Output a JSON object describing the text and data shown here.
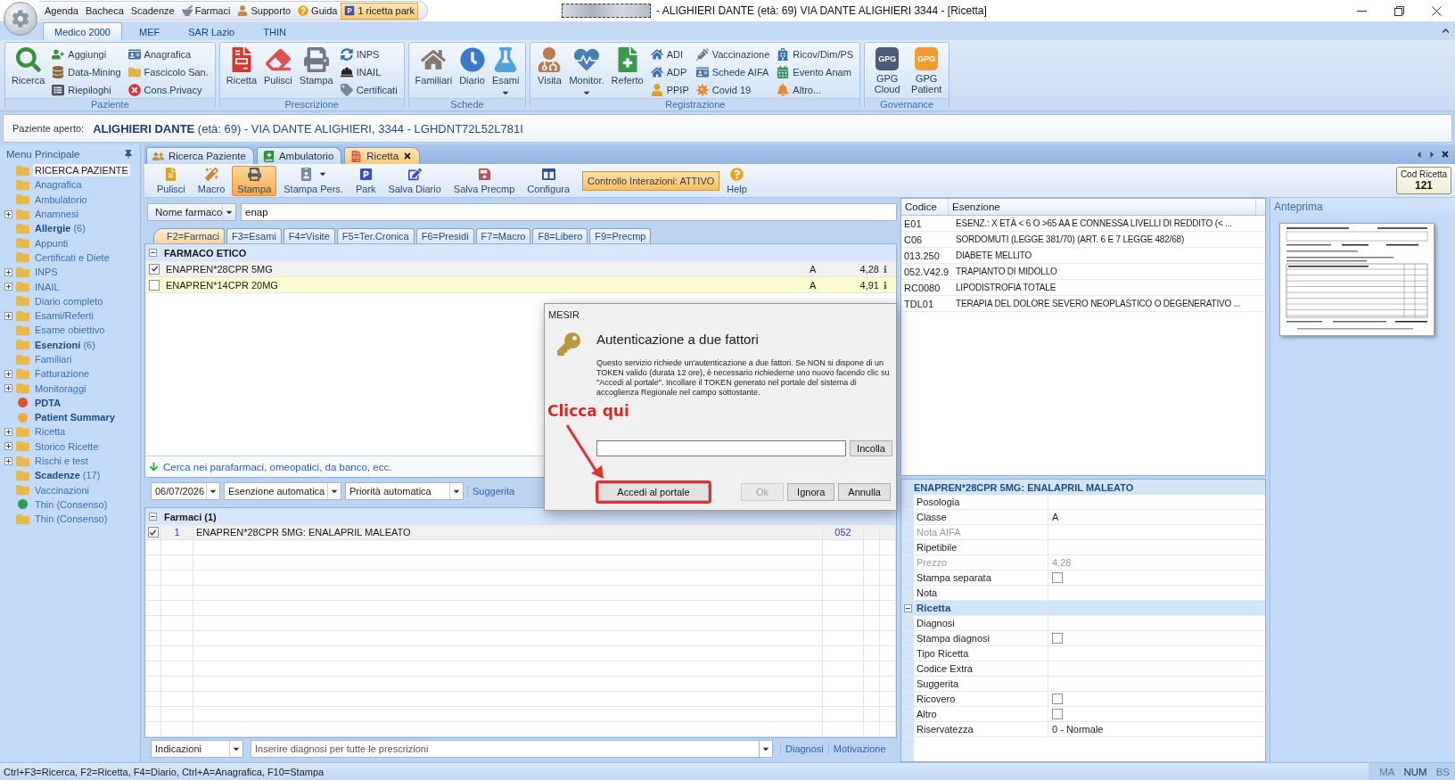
{
  "title_bar": {
    "quick_access": [
      {
        "label": "Agenda",
        "highlighted": false
      },
      {
        "label": "Bacheca",
        "highlighted": false
      },
      {
        "label": "Scadenze",
        "highlighted": false
      },
      {
        "label": "Farmaci",
        "highlighted": false
      },
      {
        "label": "Supporto",
        "highlighted": false
      },
      {
        "label": "Guida",
        "highlighted": false
      },
      {
        "label": "1 ricetta park",
        "highlighted": true
      }
    ],
    "title": "- ALIGHIERI DANTE (età: 69) VIA DANTE ALIGHIERI 3344 - [Ricetta]"
  },
  "ribbon": {
    "tabs": [
      {
        "label": "Medico 2000",
        "selected": true
      },
      {
        "label": "MEF",
        "selected": false
      },
      {
        "label": "SAR Lazio",
        "selected": false
      },
      {
        "label": "THIN",
        "selected": false
      }
    ],
    "groups": [
      {
        "label": "Paziente",
        "large": [
          {
            "label": "Ricerca",
            "dropdown": false
          }
        ],
        "columns": [
          [
            {
              "label": "Aggiungi"
            },
            {
              "label": "Data-Mining"
            },
            {
              "label": "Riepiloghi"
            }
          ],
          [
            {
              "label": "Anagrafica"
            },
            {
              "label": "Fascicolo San."
            },
            {
              "label": "Cons.Privacy"
            }
          ]
        ]
      },
      {
        "label": "Prescrizione",
        "large": [
          {
            "label": "Ricetta",
            "dropdown": false
          },
          {
            "label": "Pulisci",
            "dropdown": false
          },
          {
            "label": "Stampa",
            "dropdown": false
          }
        ],
        "columns": [
          [
            {
              "label": "INPS"
            },
            {
              "label": "INAIL"
            },
            {
              "label": "Certificati"
            }
          ]
        ]
      },
      {
        "label": "Schede",
        "large": [
          {
            "label": "Familiari",
            "dropdown": false
          },
          {
            "label": "Diario",
            "dropdown": false
          },
          {
            "label": "Esami",
            "dropdown": true
          }
        ]
      },
      {
        "label": "Registrazione",
        "large": [
          {
            "label": "Visita",
            "dropdown": false
          },
          {
            "label": "Monitor.",
            "dropdown": true
          },
          {
            "label": "Referto",
            "dropdown": false
          }
        ],
        "columns": [
          [
            {
              "label": "ADI"
            },
            {
              "label": "ADP"
            },
            {
              "label": "PPIP"
            }
          ],
          [
            {
              "label": "Vaccinazione"
            },
            {
              "label": "Schede AIFA"
            },
            {
              "label": "Covid 19"
            }
          ],
          [
            {
              "label": "Ricov/Dim/PS"
            },
            {
              "label": "Evento Anam"
            },
            {
              "label": "Altro..."
            }
          ]
        ]
      },
      {
        "label": "Governance",
        "large": [
          {
            "label": "GPG Cloud",
            "logo": "GPG",
            "color": "#4b5b78"
          },
          {
            "label": "GPG Patient",
            "logo": "GPG",
            "color": "#f39b2f"
          }
        ]
      }
    ]
  },
  "patient_bar": {
    "label": "Paziente aperto:",
    "patient": "**ALIGHIERI DANTE** (età: 69) - VIA DANTE ALIGHIERI, 3344 - LGHDNT72L52L781I"
  },
  "sidebar": {
    "title": "Menu Principale",
    "items": [
      {
        "label": "RICERCA PAZIENTE",
        "kind": "folder",
        "bold": false,
        "expandable": false,
        "selected": true
      },
      {
        "label": "Anagrafica",
        "kind": "folder",
        "bold": false,
        "expandable": false,
        "selected": false
      },
      {
        "label": "Ambulatorio",
        "kind": "folder",
        "bold": false,
        "expandable": false,
        "selected": false
      },
      {
        "label": "Anamnesi",
        "kind": "folder",
        "bold": false,
        "expandable": true,
        "selected": false
      },
      {
        "label": "Allergie",
        "count": "(6)",
        "kind": "folder",
        "bold": true,
        "expandable": false,
        "selected": false
      },
      {
        "label": "Appunti",
        "kind": "folder",
        "bold": false,
        "expandable": false,
        "selected": false
      },
      {
        "label": "Certificati e Diete",
        "kind": "folder",
        "bold": false,
        "expandable": false,
        "selected": false
      },
      {
        "label": "INPS",
        "kind": "folder",
        "bold": false,
        "expandable": true,
        "selected": false
      },
      {
        "label": "INAIL",
        "kind": "folder",
        "bold": false,
        "expandable": true,
        "selected": false
      },
      {
        "label": "Diario completo",
        "kind": "folder",
        "bold": false,
        "expandable": false,
        "selected": false
      },
      {
        "label": "Esami/Referti",
        "kind": "folder",
        "bold": false,
        "expandable": true,
        "selected": false
      },
      {
        "label": "Esame obiettivo",
        "kind": "folder",
        "bold": false,
        "expandable": false,
        "selected": false
      },
      {
        "label": "Esenzioni",
        "count": "(6)",
        "kind": "folder",
        "bold": true,
        "expandable": false,
        "selected": false
      },
      {
        "label": "Familiari",
        "kind": "folder",
        "bold": false,
        "expandable": false,
        "selected": false
      },
      {
        "label": "Fatturazione",
        "kind": "folder",
        "bold": false,
        "expandable": true,
        "selected": false
      },
      {
        "label": "Monitoraggi",
        "kind": "folder",
        "bold": false,
        "expandable": true,
        "selected": false
      },
      {
        "label": "PDTA",
        "kind": "dot",
        "color": "#e0542c",
        "bold": true,
        "expandable": false,
        "selected": false
      },
      {
        "label": "Patient Summary",
        "kind": "dot",
        "color": "#f2a93b",
        "bold": true,
        "expandable": false,
        "selected": false
      },
      {
        "label": "Ricetta",
        "kind": "folder",
        "bold": false,
        "expandable": true,
        "selected": false
      },
      {
        "label": "Storico Ricette",
        "kind": "folder",
        "bold": false,
        "expandable": true,
        "selected": false
      },
      {
        "label": "Rischi e test",
        "kind": "folder",
        "bold": false,
        "expandable": true,
        "selected": false
      },
      {
        "label": "Scadenze",
        "count": "(17)",
        "kind": "folder",
        "bold": true,
        "expandable": false,
        "selected": false
      },
      {
        "label": "Vaccinazioni",
        "kind": "folder",
        "bold": false,
        "expandable": false,
        "selected": false
      },
      {
        "label": "Thin (Consenso)",
        "kind": "dot",
        "color": "#2e9d4f",
        "bold": false,
        "expandable": false,
        "selected": false
      },
      {
        "label": "Thin (Consenso)",
        "kind": "folder",
        "bold": false,
        "expandable": false,
        "selected": false
      }
    ]
  },
  "document_tabs": [
    {
      "label": "Ricerca Paziente",
      "selected": false
    },
    {
      "label": "Ambulatorio",
      "selected": false
    },
    {
      "label": "Ricetta",
      "selected": true
    }
  ],
  "toolbar": {
    "buttons": [
      {
        "label": "Pulisci",
        "active": false,
        "dropdown": false
      },
      {
        "label": "Macro",
        "active": false,
        "dropdown": false
      },
      {
        "label": "Stampa",
        "active": true,
        "dropdown": false
      },
      {
        "label": "Stampa Pers.",
        "active": false,
        "dropdown": true
      },
      {
        "label": "Park",
        "active": false,
        "dropdown": false
      },
      {
        "label": "Salva Diario",
        "active": false,
        "dropdown": false
      },
      {
        "label": "Salva Precmp",
        "active": false,
        "dropdown": false
      },
      {
        "label": "Configura",
        "active": false,
        "dropdown": false
      }
    ],
    "interaction_check": "Controllo Interazioni: ATTIVO",
    "help": "Help",
    "code": {
      "label": "Cod Ricetta",
      "value": "121"
    }
  },
  "drug_search": {
    "mode": "Nome farmaco",
    "query": "enap"
  },
  "category_tabs": [
    {
      "label": "F2=Farmaci",
      "selected": true
    },
    {
      "label": "F3=Esami",
      "selected": false
    },
    {
      "label": "F4=Visite",
      "selected": false
    },
    {
      "label": "F5=Ter.Cronica",
      "selected": false
    },
    {
      "label": "F6=Presidi",
      "selected": false
    },
    {
      "label": "F7=Macro",
      "selected": false
    },
    {
      "label": "F8=Libero",
      "selected": false
    },
    {
      "label": "F9=Precmp",
      "selected": false
    }
  ],
  "drug_list": {
    "group": "FARMACO ETICO",
    "expanded": true,
    "rows": [
      {
        "name": "ENAPREN*28CPR 5MG",
        "checked": true,
        "selected": false,
        "class": "A",
        "price": "4,28"
      },
      {
        "name": "ENAPREN*14CPR 20MG",
        "checked": false,
        "selected": true,
        "class": "A",
        "price": "4,91"
      }
    ],
    "more_link": "Cerca nei parafarmaci, omeopatici, da banco, ecc."
  },
  "prescription": {
    "date": "06/07/2026",
    "exemption": "Esenzione automatica",
    "priority": "Priorità automatica",
    "suggest_link": "Suggerita",
    "group": "Farmaci (1)",
    "expanded": true,
    "items": [
      {
        "checked": true,
        "number": "1",
        "description": "ENAPREN*28CPR 5MG: ENALAPRIL MALEATO",
        "code": "052"
      }
    ],
    "indications": "Indicazioni",
    "diagnosis_placeholder": "Inserire diagnosi per tutte le prescrizioni",
    "links": [
      "Diagnosi",
      "Motivazione"
    ]
  },
  "exemptions": {
    "columns": [
      "Codice",
      "Esenzione"
    ],
    "rows": [
      {
        "code": "E01",
        "description": "ESENZ.: X ETÀ < 6 O >65 AA E CONNESSA LIVELLI DI REDDITO (< ..."
      },
      {
        "code": "C06",
        "description": "SORDOMUTI (LEGGE 381/70) (ART. 6 E 7 LEGGE 482/68)"
      },
      {
        "code": "013.250",
        "description": "DIABETE MELLITO"
      },
      {
        "code": "052.V42.9",
        "description": "TRAPIANTO DI MIDOLLO"
      },
      {
        "code": "RC0080",
        "description": "LIPODISTROFIA TOTALE"
      },
      {
        "code": "TDL01",
        "description": "TERAPIA DEL DOLORE SEVERO NEOPLASTICO O DEGENERATIVO ..."
      }
    ]
  },
  "preview": {
    "title": "Anteprima"
  },
  "detail_panel": {
    "title": "ENAPREN*28CPR 5MG: ENALAPRIL MALEATO",
    "properties": [
      {
        "name": "Posologia",
        "kind": "text",
        "disabled": false
      },
      {
        "name": "Classe",
        "kind": "text",
        "value": "A",
        "disabled": false
      },
      {
        "name": "Nota AIFA",
        "kind": "text",
        "disabled": true
      },
      {
        "name": "Ripetibile",
        "kind": "text",
        "disabled": false
      },
      {
        "name": "Prezzo",
        "kind": "text",
        "value": "4,28",
        "disabled": true
      },
      {
        "name": "Stampa separata",
        "kind": "checkbox",
        "checked": false,
        "disabled": false
      },
      {
        "name": "Nota",
        "kind": "text",
        "disabled": false
      }
    ],
    "sections": [
      {
        "title": "Ricetta",
        "expanded": true,
        "properties": [
          {
            "name": "Diagnosi",
            "kind": "text",
            "disabled": false
          },
          {
            "name": "Stampa diagnosi",
            "kind": "checkbox",
            "checked": false,
            "disabled": false
          },
          {
            "name": "Tipo Ricetta",
            "kind": "text",
            "disabled": false
          },
          {
            "name": "Codice Extra",
            "kind": "text",
            "disabled": false
          },
          {
            "name": "Suggerita",
            "kind": "text",
            "disabled": false
          },
          {
            "name": "Ricovero",
            "kind": "checkbox",
            "checked": false,
            "disabled": false
          },
          {
            "name": "Altro",
            "kind": "checkbox",
            "checked": false,
            "disabled": false
          },
          {
            "name": "Riservatezza",
            "kind": "text",
            "value": "0 - Normale",
            "disabled": false
          }
        ]
      }
    ]
  },
  "status_bar": {
    "text": "Ctrl+F3=Ricerca, F2=Ricetta, F4=Diario, Ctrl+A=Anagrafica, F10=Stampa",
    "indicators": [
      {
        "label": "MA",
        "on": false
      },
      {
        "label": "NUM",
        "on": true
      },
      {
        "label": "BS",
        "on": false
      }
    ]
  },
  "dialog": {
    "title": "MESIR",
    "heading": "Autenticazione a due fattori",
    "message": "Questo servizio richiede un'autenticazione a due fattori. Se NON si dispone di un TOKEN valido (durata 12 ore), è necessario richiederne uno nuovo facendo clic su \"Accedi al portale\". Incollare il TOKEN generato nel portale del sistema di accoglienza Regionale nel campo sottostante.",
    "paste_button": "Incolla",
    "buttons": [
      {
        "label": "Accedi al portale",
        "highlighted": true,
        "disabled": false
      },
      {
        "label": "Ok",
        "highlighted": false,
        "disabled": true
      },
      {
        "label": "Ignora",
        "highlighted": false,
        "disabled": false
      },
      {
        "label": "Annulla",
        "highlighted": false,
        "disabled": false
      }
    ],
    "annotation": "Clicca qui"
  }
}
